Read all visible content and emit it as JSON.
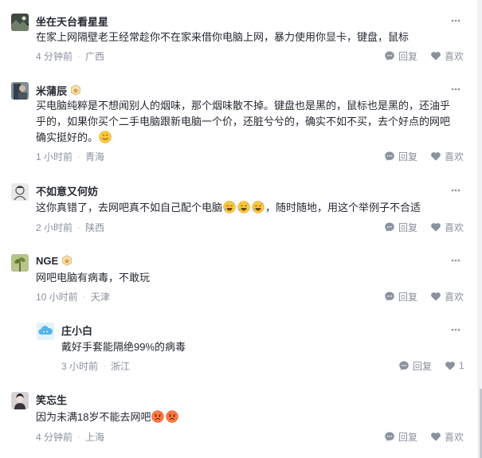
{
  "comments": [
    {
      "user": "坐在天台看星星",
      "content": "在家上网隔壁老王经常趁你不在家来借你电脑上网，暴力使用你显卡，键盘，鼠标",
      "time": "4 分钟前",
      "location": "广西",
      "reply_label": "回复",
      "like_label": "喜欢",
      "icons": {
        "avatar": "avatar-landscape-icon",
        "more": "more-dots-icon",
        "reply": "comment-bubble-icon",
        "like": "heart-icon"
      }
    },
    {
      "user": "米蒲辰",
      "content": "买电脑纯粹是不想闻别人的烟味，那个烟味散不掉。键盘也是黑的，鼠标也是黑的，还油乎乎的，如果你买个二手电脑跟新电脑一个价，还脏兮兮的，确实不如不买，去个好点的网吧确实挺好的。",
      "time": "1 小时前",
      "location": "青海",
      "reply_label": "回复",
      "like_label": "喜欢",
      "icons": {
        "avatar": "avatar-portrait-icon",
        "badge": "level-badge-icon",
        "emoji": "smile-emoji-icon"
      }
    },
    {
      "user": "不如意又何妨",
      "content_before": "这你真错了，去网吧真不如自己配个电脑",
      "content_after": "，随时随地，用这个举例子不合适",
      "time": "2 小时前",
      "location": "陕西",
      "reply_label": "回复",
      "like_label": "喜欢",
      "icons": {
        "avatar": "avatar-sketch-icon",
        "emoji": "sweat-laugh-emoji-icon"
      }
    },
    {
      "user": "NGE",
      "content": "网吧电脑有病毒，不敢玩",
      "time": "10 小时前",
      "location": "天津",
      "reply_label": "回复",
      "like_label": "喜欢",
      "icons": {
        "avatar": "avatar-plant-icon",
        "badge": "level-badge-icon"
      }
    },
    {
      "user": "庄小白",
      "content": "戴好手套能隔绝99%的病毒",
      "time": "3 小时前",
      "location": "浙江",
      "reply_label": "回复",
      "like_count": "1",
      "icons": {
        "avatar": "avatar-cloud-icon"
      }
    },
    {
      "user": "笑忘生",
      "content": "因为未满18岁不能去网吧",
      "time": "4 分钟前",
      "location": "上海",
      "reply_label": "回复",
      "like_label": "喜欢",
      "icons": {
        "avatar": "avatar-character-icon",
        "emoji": "angry-emoji-icon"
      }
    }
  ],
  "colors": {
    "text": "#252933",
    "meta": "#8a919f",
    "badge": "#e8c27a",
    "emoji": "#ffc83d",
    "angry": "#ff6b3d"
  }
}
